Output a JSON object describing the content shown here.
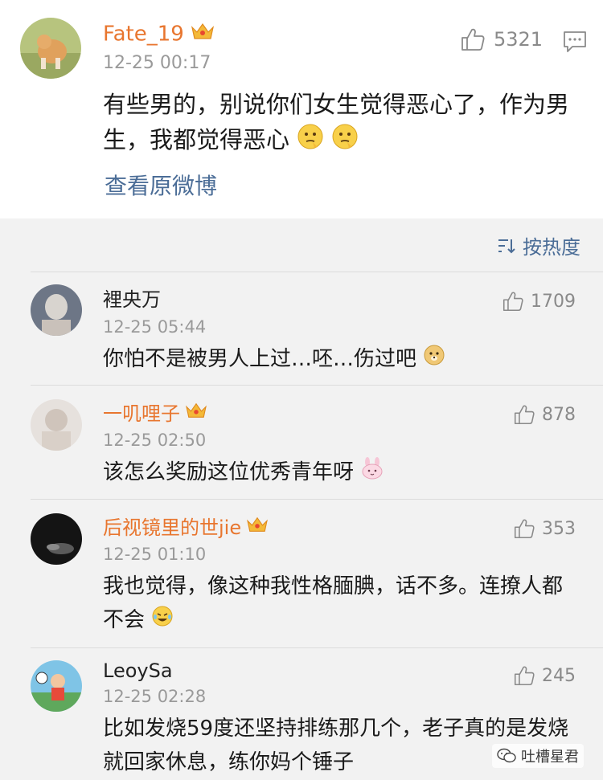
{
  "main_post": {
    "user": "Fate_19",
    "time": "12-25 00:17",
    "like_count": "5321",
    "text": "有些男的，别说你们女生觉得恶心了，作为男生，我都觉得恶心",
    "view_original": "查看原微博"
  },
  "sort": {
    "label": "按热度"
  },
  "comments": [
    {
      "user": "裡央万",
      "time": "12-25 05:44",
      "like_count": "1709",
      "text": "你怕不是被男人上过…呸…伤过吧"
    },
    {
      "user": "一叽哩子",
      "time": "12-25 02:50",
      "like_count": "878",
      "text": "该怎么奖励这位优秀青年呀"
    },
    {
      "user": "后视镜里的世jie",
      "time": "12-25 01:10",
      "like_count": "353",
      "text": "我也觉得，像这种我性格腼腆，话不多。连撩人都不会"
    },
    {
      "user": "LeoySa",
      "time": "12-25 02:28",
      "like_count": "245",
      "text": "比如发烧59度还坚持排练那几个，老子真的是发烧就回家休息，练你妈个锤子"
    }
  ],
  "watermark": {
    "label": "吐槽星君"
  },
  "colors": {
    "vip_name": "#e8762f",
    "link": "#4b6d97",
    "muted": "#9a9a9a"
  }
}
